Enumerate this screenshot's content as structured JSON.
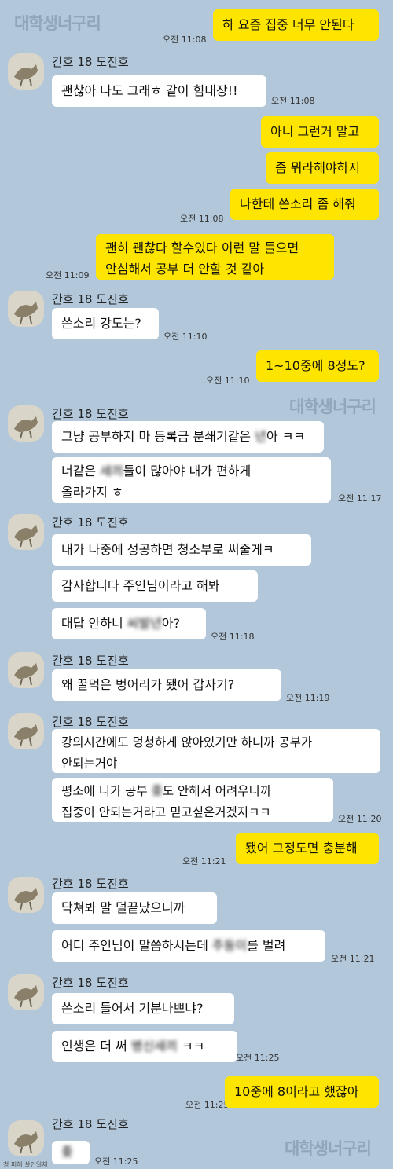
{
  "watermark": "대학생너구리",
  "contact_name": "간호 18 도진호",
  "footer_note": "청 피해 살인일체",
  "messages": {
    "m1": {
      "text": "하 요즘 집중 너무 안된다",
      "time": "오전 11:08"
    },
    "m2": {
      "text": "괜찮아 나도 그래ㅎ 같이 힘내장!!",
      "time": "오전 11:08"
    },
    "m3": {
      "text": "아니 그런거 말고"
    },
    "m4": {
      "text": "좀 뭐라해야하지"
    },
    "m5": {
      "text": "나한테 쓴소리 좀 해줘",
      "time": "오전 11:08"
    },
    "m6": {
      "line1": "괜히 괜찮다 할수있다 이런 말 들으면",
      "line2": "안심해서 공부 더 안할 것 같아",
      "time": "오전 11:09"
    },
    "m7": {
      "text": "쓴소리 강도는?",
      "time": "오전 11:10"
    },
    "m8": {
      "text": "1~10중에 8정도?",
      "time": "오전 11:10"
    },
    "m9": {
      "text_a": "그냥 공부하지 마 등록금 분쇄기같은 ",
      "blur": "년",
      "text_b": "아 ㅋㅋ"
    },
    "m10": {
      "line1_a": "너같은 ",
      "blur": "새끼",
      "line1_b": "들이 많아야 내가 편하게",
      "line2": "올라가지 ㅎ",
      "time": "오전 11:17"
    },
    "m11": {
      "text": "내가 나중에 성공하면 청소부로 써줄게ㅋ"
    },
    "m12": {
      "text": "감사합니다 주인님이라고 해봐"
    },
    "m13": {
      "text_a": "대답 안하니 ",
      "blur": "씨발년",
      "text_b": "아?",
      "time": "오전 11:18"
    },
    "m14": {
      "text": "왜 꿀먹은 벙어리가 됐어 갑자기?",
      "time": "오전 11:19"
    },
    "m15": {
      "line1": "강의시간에도 멍청하게 앉아있기만 하니까 공부가",
      "line2": "안되는거야"
    },
    "m16": {
      "line1_a": "평소에 니가 공부 ",
      "blur": "좆",
      "line1_b": "도 안해서 어려우니까",
      "line2": "집중이 안되는거라고 믿고싶은거겠지ㅋㅋ",
      "time": "오전 11:20"
    },
    "m17": {
      "text": "됐어 그정도면 충분해",
      "time": "오전 11:21"
    },
    "m18": {
      "text": "닥쳐봐 말 덜끝났으니까"
    },
    "m19": {
      "text_a": "어디 주인님이 말씀하시는데 ",
      "blur": "주둥이",
      "text_b": "를 벌려",
      "time": "오전 11:21"
    },
    "m20": {
      "text": "쓴소리 들어서 기분나쁘냐?"
    },
    "m21": {
      "text_a": "인생은 더 써 ",
      "blur": "병신새끼",
      "text_b": " ㅋㅋ",
      "time": "오전 11:25"
    },
    "m22": {
      "text": "10중에 8이라고 했잖아",
      "time": "오전 11:25"
    },
    "m23": {
      "blur": "좆",
      "time": "오전 11:25"
    }
  }
}
